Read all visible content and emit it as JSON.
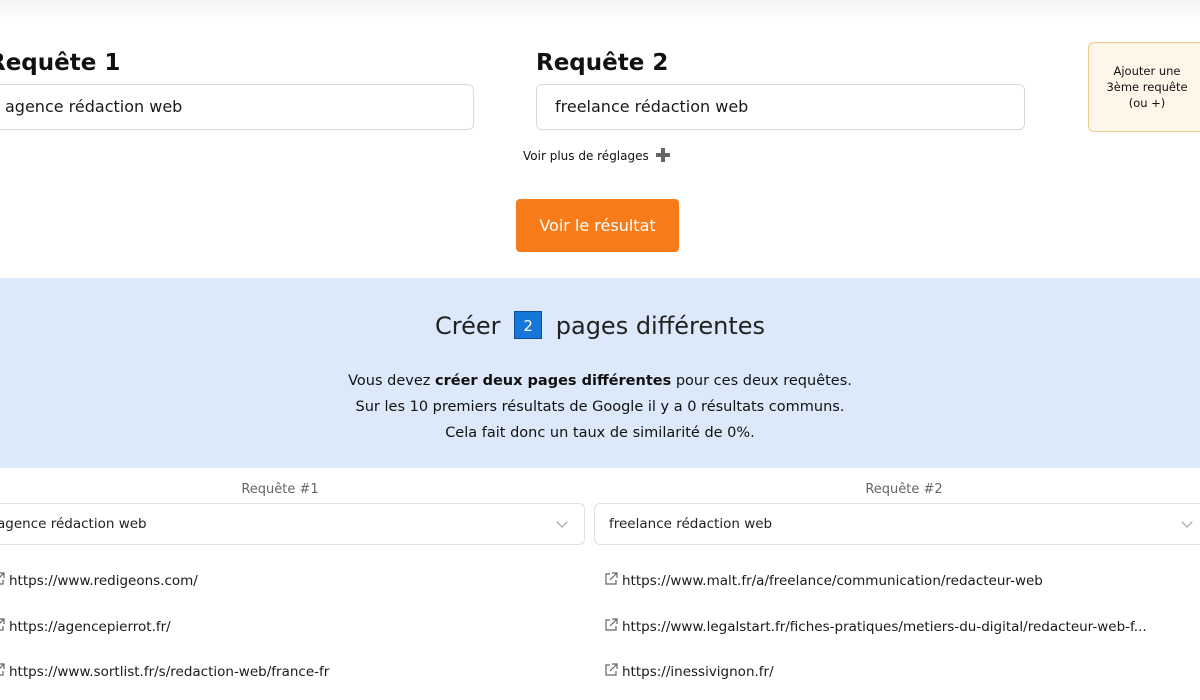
{
  "queries": {
    "q1": {
      "label": "Requête 1",
      "value": "agence rédaction web"
    },
    "q2": {
      "label": "Requête 2",
      "value": "freelance rédaction web"
    }
  },
  "add_query": {
    "line1": "Ajouter une",
    "line2": "3ème requête",
    "line3": "(ou +)"
  },
  "more_settings": {
    "label": "Voir plus de réglages",
    "icon": "plus-icon"
  },
  "result_button": {
    "label": "Voir le résultat"
  },
  "banner": {
    "title_before": "Créer",
    "count": "2",
    "title_after": "pages différentes",
    "line1_before": "Vous devez ",
    "line1_bold": "créer deux pages différentes",
    "line1_after": " pour ces deux requêtes.",
    "line2": "Sur les 10 premiers résultats de Google il y a 0 résultats communs.",
    "line3": "Cela fait donc un taux de similarité de 0%."
  },
  "columns": [
    {
      "label": "Requête #1",
      "selected": "agence rédaction web",
      "urls": [
        "https://www.redigeons.com/",
        "https://agencepierrot.fr/",
        "https://www.sortlist.fr/s/redaction-web/france-fr"
      ]
    },
    {
      "label": "Requête #2",
      "selected": "freelance rédaction web",
      "urls": [
        "https://www.malt.fr/a/freelance/communication/redacteur-web",
        "https://www.legalstart.fr/fiches-pratiques/metiers-du-digital/redacteur-web-f...",
        "https://inessivignon.fr/"
      ]
    }
  ],
  "colors": {
    "accent": "#f77b18",
    "banner_bg": "#dce9fa",
    "badge": "#1777d8"
  }
}
